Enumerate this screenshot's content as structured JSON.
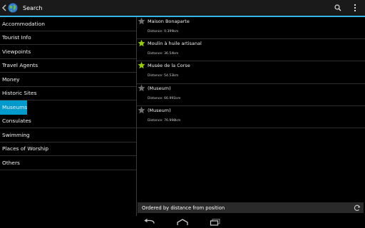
{
  "app": {
    "title": "Search",
    "accent": "#33b5e5",
    "icons": {
      "up": "chevron-left-icon",
      "app": "globe-icon",
      "search": "search-icon",
      "overflow": "overflow-menu-icon"
    }
  },
  "sidebar": {
    "selected_color": "#0099cc",
    "items": [
      {
        "label": "Accommodation"
      },
      {
        "label": "Tourist Info"
      },
      {
        "label": "Viewpoints"
      },
      {
        "label": "Travel Agents"
      },
      {
        "label": "Money"
      },
      {
        "label": "Historic Sites"
      },
      {
        "label": "Museums",
        "selected": true
      },
      {
        "label": "Consulates"
      },
      {
        "label": "Swimming"
      },
      {
        "label": "Places of Worship"
      },
      {
        "label": "Others"
      }
    ]
  },
  "results": {
    "items": [
      {
        "name": "Maison Bonaparte",
        "distance": "Distance: 0.399km",
        "starred": false
      },
      {
        "name": "Moulin à huile artisanal",
        "distance": "Distance: 36.54km",
        "starred": true
      },
      {
        "name": "Musée de la Corse",
        "distance": "Distance: 54.53km",
        "starred": true
      },
      {
        "name": "(Museum)",
        "distance": "Distance: 66.991km",
        "starred": false
      },
      {
        "name": "(Museum)",
        "distance": "Distance: 76.998km",
        "starred": false
      }
    ],
    "star_colors": {
      "on": "#99cc00",
      "off": "#6e6e6e"
    }
  },
  "status": {
    "text": "Ordered by distance from position",
    "icon": "refresh-icon"
  },
  "navbar": {
    "icons": [
      "back-icon",
      "home-icon",
      "recent-apps-icon"
    ]
  }
}
